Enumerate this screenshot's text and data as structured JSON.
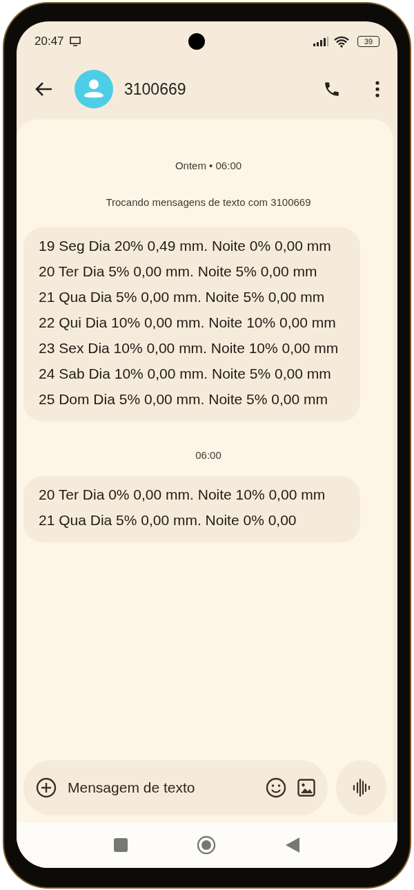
{
  "status_bar": {
    "time": "20:47",
    "battery": "39"
  },
  "header": {
    "contact": "3100669"
  },
  "conversation": [
    {
      "kind": "timestamp",
      "text": "Ontem • 06:00"
    },
    {
      "kind": "info",
      "text": "Trocando mensagens de texto com 3100669"
    },
    {
      "kind": "message",
      "lines": [
        "19 Seg Dia 20% 0,49 mm. Noite 0% 0,00 mm",
        "20 Ter Dia 5% 0,00 mm. Noite 5% 0,00 mm",
        "21 Qua Dia 5% 0,00 mm. Noite 5% 0,00 mm",
        "22 Qui Dia 10% 0,00 mm. Noite 10% 0,00 mm",
        "23 Sex Dia 10% 0,00 mm. Noite 10% 0,00 mm",
        "24 Sab Dia 10% 0,00 mm. Noite 5% 0,00 mm",
        "25 Dom Dia 5% 0,00 mm. Noite 5% 0,00 mm"
      ]
    },
    {
      "kind": "timestamp",
      "text": "06:00"
    },
    {
      "kind": "message",
      "lines": [
        "20 Ter Dia 0% 0,00 mm. Noite 10% 0,00 mm",
        "21 Qua Dia 5% 0,00 mm. Noite 0% 0,00"
      ]
    }
  ],
  "composer": {
    "placeholder": "Mensagem de texto"
  }
}
